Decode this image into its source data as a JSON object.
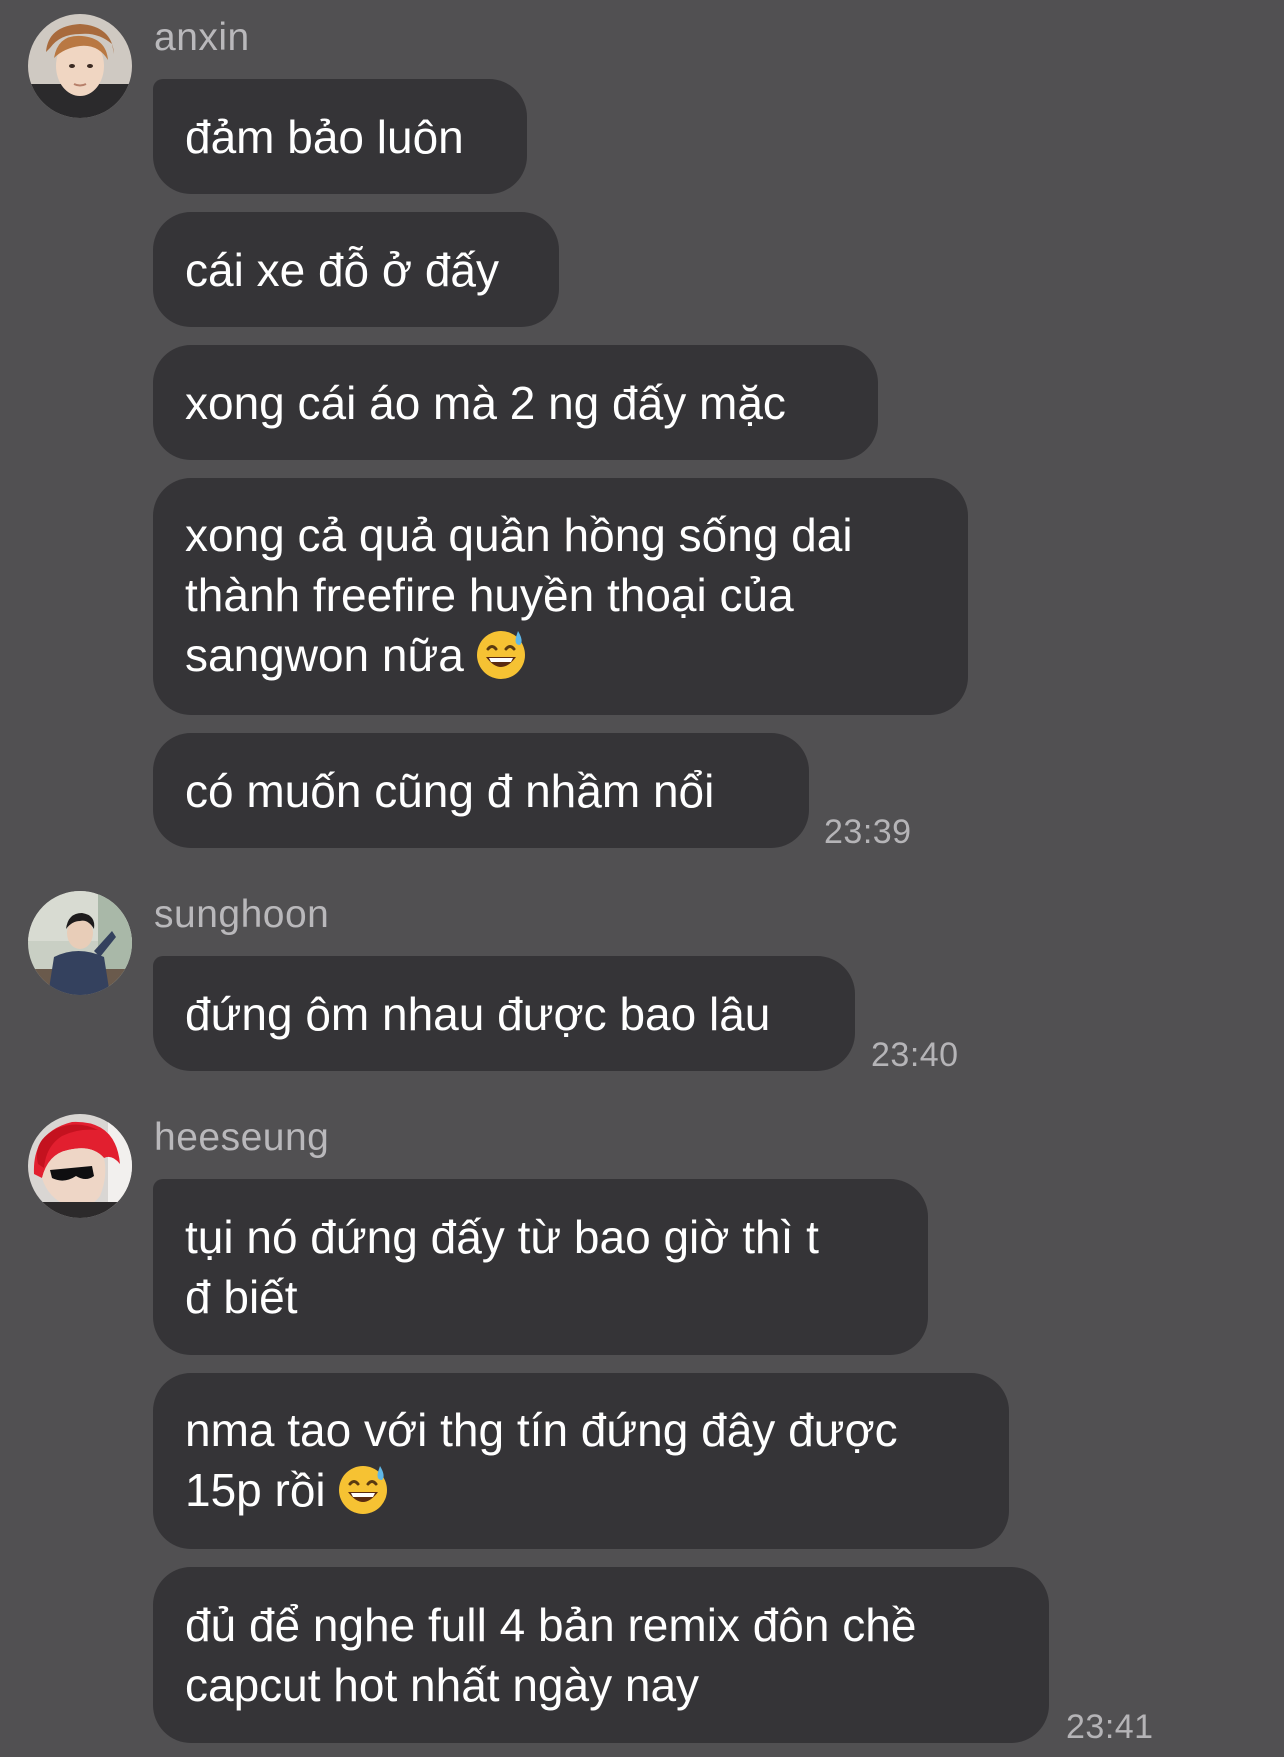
{
  "groups": [
    {
      "sender": "anxin",
      "avatar_icon": "avatar-anxin",
      "messages": [
        {
          "lines": [
            "đảm bảo luôn"
          ]
        },
        {
          "lines": [
            "cái xe đỗ ở đấy"
          ]
        },
        {
          "lines": [
            "xong cái áo mà 2 ng đấy mặc"
          ]
        },
        {
          "lines": [
            "xong cả quả quần hồng sống dai",
            "thành freefire huyền thoại của",
            "sangwon nữa"
          ],
          "emoji": "sweat-smile-emoji"
        },
        {
          "lines": [
            "có muốn cũng đ nhầm nổi"
          ]
        }
      ],
      "time": "23:39"
    },
    {
      "sender": "sunghoon",
      "avatar_icon": "avatar-sunghoon",
      "messages": [
        {
          "lines": [
            "đứng ôm nhau được bao lâu"
          ]
        }
      ],
      "time": "23:40"
    },
    {
      "sender": "heeseung",
      "avatar_icon": "avatar-heeseung",
      "messages": [
        {
          "lines": [
            "tụi nó đứng đấy từ bao giờ thì t",
            "đ biết"
          ]
        },
        {
          "lines": [
            "nma tao với thg tín đứng đây được",
            "15p rồi"
          ],
          "emoji": "sweat-smile-emoji"
        },
        {
          "lines": [
            "đủ để nghe full 4 bản remix đôn chề",
            "capcut hot nhất ngày nay"
          ]
        }
      ],
      "time": "23:41"
    }
  ],
  "colors": {
    "background": "#515052",
    "bubble": "#353437",
    "text": "#ffffff",
    "meta_text": "#b9b8bb"
  }
}
